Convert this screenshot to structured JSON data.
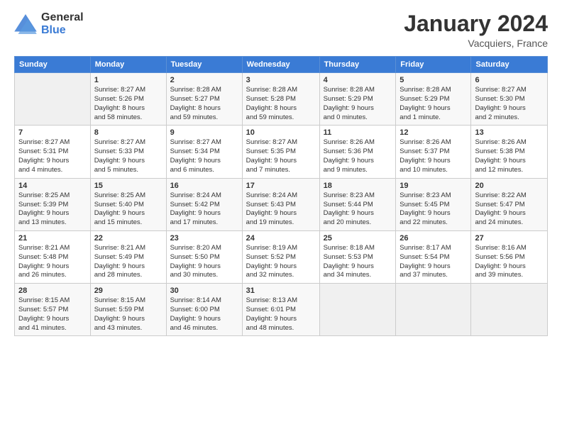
{
  "header": {
    "logo_general": "General",
    "logo_blue": "Blue",
    "month_title": "January 2024",
    "location": "Vacquiers, France"
  },
  "weekdays": [
    "Sunday",
    "Monday",
    "Tuesday",
    "Wednesday",
    "Thursday",
    "Friday",
    "Saturday"
  ],
  "weeks": [
    [
      {
        "day": "",
        "info": ""
      },
      {
        "day": "1",
        "info": "Sunrise: 8:27 AM\nSunset: 5:26 PM\nDaylight: 8 hours\nand 58 minutes."
      },
      {
        "day": "2",
        "info": "Sunrise: 8:28 AM\nSunset: 5:27 PM\nDaylight: 8 hours\nand 59 minutes."
      },
      {
        "day": "3",
        "info": "Sunrise: 8:28 AM\nSunset: 5:28 PM\nDaylight: 8 hours\nand 59 minutes."
      },
      {
        "day": "4",
        "info": "Sunrise: 8:28 AM\nSunset: 5:29 PM\nDaylight: 9 hours\nand 0 minutes."
      },
      {
        "day": "5",
        "info": "Sunrise: 8:28 AM\nSunset: 5:29 PM\nDaylight: 9 hours\nand 1 minute."
      },
      {
        "day": "6",
        "info": "Sunrise: 8:27 AM\nSunset: 5:30 PM\nDaylight: 9 hours\nand 2 minutes."
      }
    ],
    [
      {
        "day": "7",
        "info": "Sunrise: 8:27 AM\nSunset: 5:31 PM\nDaylight: 9 hours\nand 4 minutes."
      },
      {
        "day": "8",
        "info": "Sunrise: 8:27 AM\nSunset: 5:33 PM\nDaylight: 9 hours\nand 5 minutes."
      },
      {
        "day": "9",
        "info": "Sunrise: 8:27 AM\nSunset: 5:34 PM\nDaylight: 9 hours\nand 6 minutes."
      },
      {
        "day": "10",
        "info": "Sunrise: 8:27 AM\nSunset: 5:35 PM\nDaylight: 9 hours\nand 7 minutes."
      },
      {
        "day": "11",
        "info": "Sunrise: 8:26 AM\nSunset: 5:36 PM\nDaylight: 9 hours\nand 9 minutes."
      },
      {
        "day": "12",
        "info": "Sunrise: 8:26 AM\nSunset: 5:37 PM\nDaylight: 9 hours\nand 10 minutes."
      },
      {
        "day": "13",
        "info": "Sunrise: 8:26 AM\nSunset: 5:38 PM\nDaylight: 9 hours\nand 12 minutes."
      }
    ],
    [
      {
        "day": "14",
        "info": "Sunrise: 8:25 AM\nSunset: 5:39 PM\nDaylight: 9 hours\nand 13 minutes."
      },
      {
        "day": "15",
        "info": "Sunrise: 8:25 AM\nSunset: 5:40 PM\nDaylight: 9 hours\nand 15 minutes."
      },
      {
        "day": "16",
        "info": "Sunrise: 8:24 AM\nSunset: 5:42 PM\nDaylight: 9 hours\nand 17 minutes."
      },
      {
        "day": "17",
        "info": "Sunrise: 8:24 AM\nSunset: 5:43 PM\nDaylight: 9 hours\nand 19 minutes."
      },
      {
        "day": "18",
        "info": "Sunrise: 8:23 AM\nSunset: 5:44 PM\nDaylight: 9 hours\nand 20 minutes."
      },
      {
        "day": "19",
        "info": "Sunrise: 8:23 AM\nSunset: 5:45 PM\nDaylight: 9 hours\nand 22 minutes."
      },
      {
        "day": "20",
        "info": "Sunrise: 8:22 AM\nSunset: 5:47 PM\nDaylight: 9 hours\nand 24 minutes."
      }
    ],
    [
      {
        "day": "21",
        "info": "Sunrise: 8:21 AM\nSunset: 5:48 PM\nDaylight: 9 hours\nand 26 minutes."
      },
      {
        "day": "22",
        "info": "Sunrise: 8:21 AM\nSunset: 5:49 PM\nDaylight: 9 hours\nand 28 minutes."
      },
      {
        "day": "23",
        "info": "Sunrise: 8:20 AM\nSunset: 5:50 PM\nDaylight: 9 hours\nand 30 minutes."
      },
      {
        "day": "24",
        "info": "Sunrise: 8:19 AM\nSunset: 5:52 PM\nDaylight: 9 hours\nand 32 minutes."
      },
      {
        "day": "25",
        "info": "Sunrise: 8:18 AM\nSunset: 5:53 PM\nDaylight: 9 hours\nand 34 minutes."
      },
      {
        "day": "26",
        "info": "Sunrise: 8:17 AM\nSunset: 5:54 PM\nDaylight: 9 hours\nand 37 minutes."
      },
      {
        "day": "27",
        "info": "Sunrise: 8:16 AM\nSunset: 5:56 PM\nDaylight: 9 hours\nand 39 minutes."
      }
    ],
    [
      {
        "day": "28",
        "info": "Sunrise: 8:15 AM\nSunset: 5:57 PM\nDaylight: 9 hours\nand 41 minutes."
      },
      {
        "day": "29",
        "info": "Sunrise: 8:15 AM\nSunset: 5:59 PM\nDaylight: 9 hours\nand 43 minutes."
      },
      {
        "day": "30",
        "info": "Sunrise: 8:14 AM\nSunset: 6:00 PM\nDaylight: 9 hours\nand 46 minutes."
      },
      {
        "day": "31",
        "info": "Sunrise: 8:13 AM\nSunset: 6:01 PM\nDaylight: 9 hours\nand 48 minutes."
      },
      {
        "day": "",
        "info": ""
      },
      {
        "day": "",
        "info": ""
      },
      {
        "day": "",
        "info": ""
      }
    ]
  ]
}
